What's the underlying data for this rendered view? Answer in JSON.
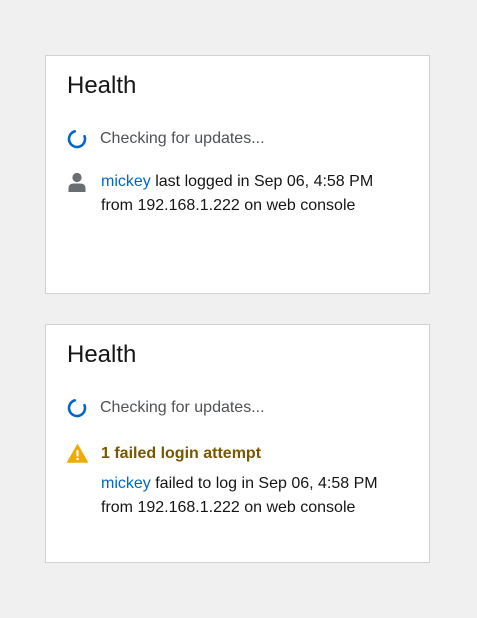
{
  "cards": [
    {
      "title": "Health",
      "status_text": "Checking for updates...",
      "login": {
        "user": "mickey",
        "line1_rest": " last logged in Sep 06, 4:58 PM",
        "line2": "from 192.168.1.222 on web console"
      }
    },
    {
      "title": "Health",
      "status_text": "Checking for updates...",
      "warning": {
        "title": "1 failed login attempt",
        "user": "mickey",
        "line1_rest": " failed to log in Sep 06, 4:58 PM",
        "line2": "from 192.168.1.222 on web console"
      }
    }
  ],
  "colors": {
    "link": "#0066cc",
    "spinner": "#0066cc",
    "warning_icon": "#f0ab00",
    "warning_text": "#795600",
    "user_icon": "#6a6e73"
  },
  "icons": {
    "spinner": "spinner-icon",
    "user": "user-icon",
    "warning": "warning-triangle-icon"
  }
}
